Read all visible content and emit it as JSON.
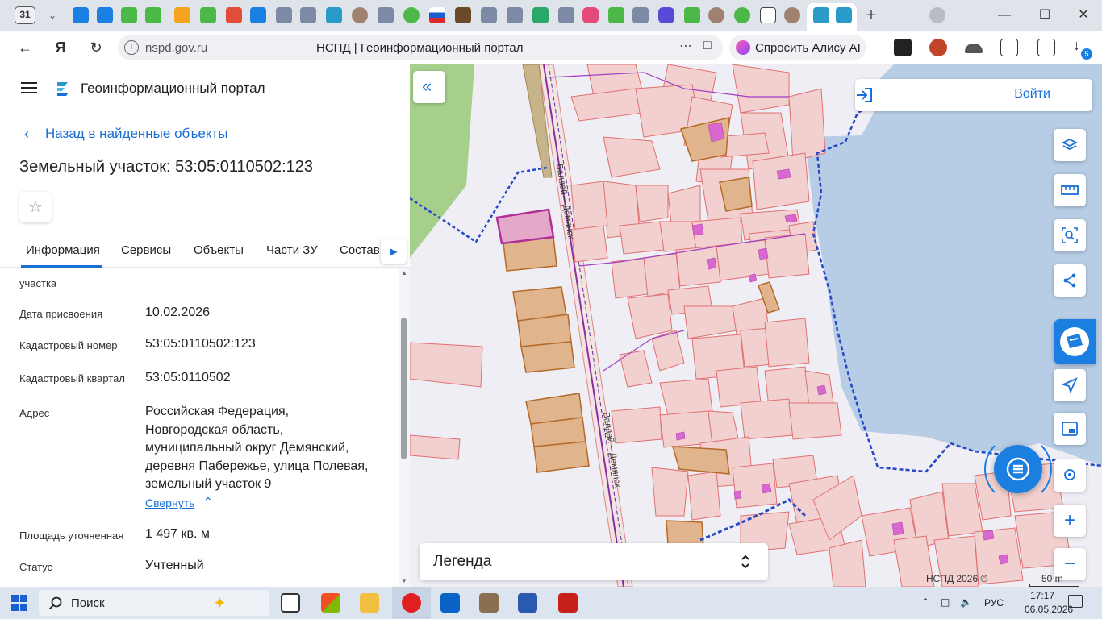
{
  "browser": {
    "tab_count": "31",
    "url": "nspd.gov.ru",
    "page_title": "НСПД | Геоинформационный портал",
    "alice_label": "Спросить Алису AI",
    "downloads_badge": "5"
  },
  "portal": {
    "name": "Геоинформационный портал",
    "back_label": "Назад в найденные объекты",
    "object_title": "Земельный участок: 53:05:0110502:123",
    "tabs": [
      "Информация",
      "Сервисы",
      "Объекты",
      "Части ЗУ",
      "Состав"
    ],
    "active_tab": "Информация"
  },
  "properties": {
    "partial_label": "участка",
    "rows": [
      {
        "label": "Дата присвоения",
        "value": "10.02.2026"
      },
      {
        "label": "Кадастровый номер",
        "value": "53:05:0110502:123"
      },
      {
        "label": "Кадастровый квартал",
        "value": "53:05:0110502"
      }
    ],
    "address_label": "Адрес",
    "address_lines": [
      "Российская Федерация,",
      "Новгородская область,",
      "муниципальный округ Демянский,",
      "деревня Паберeжье, улица Полевая,",
      "земельный участок 9"
    ],
    "collapse_label": "Свернуть",
    "area_label": "Площадь уточненная",
    "area_value": "1 497 кв. м",
    "status_label": "Статус",
    "status_value": "Учтенный"
  },
  "map": {
    "login_label": "Войти",
    "legend_label": "Легенда",
    "copyright": "НСПД 2026 ©",
    "scale_label": "50 m",
    "road_label": "Валдай – Демянск",
    "colors": {
      "parcel_fill": "#f2d0d0",
      "parcel_stroke": "#e07070",
      "selected_fill": "#e4a8c8",
      "selected_stroke": "#b0309a",
      "building_fill": "#e0b48c",
      "building_stroke": "#b46a28",
      "water": "#b7cde6",
      "forest": "#a6cf8c",
      "boundary": "#2448c8",
      "accent": "#1a6fd6"
    }
  },
  "taskbar": {
    "search_label": "Поиск",
    "language": "РУС",
    "time": "17:17",
    "date": "06.05.2026"
  }
}
